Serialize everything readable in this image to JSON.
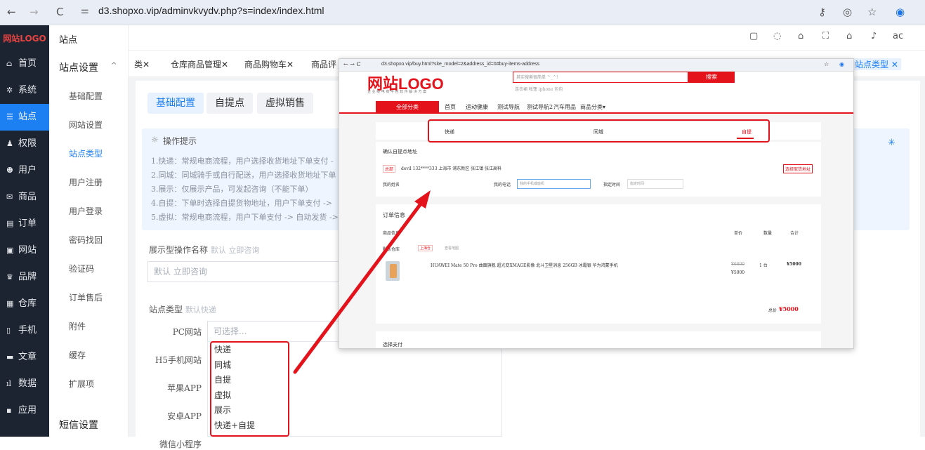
{
  "browser": {
    "back": "←",
    "forward": "→",
    "reload": "C",
    "site_info": "⚌",
    "url": "d3.shopxo.vip/adminvkvydv.php?s=index/index.html"
  },
  "sidebar": {
    "logo": "网站LOGO",
    "items": [
      {
        "icon": "⌂",
        "label": "首页"
      },
      {
        "icon": "✲",
        "label": "系统"
      },
      {
        "icon": "☰",
        "label": "站点"
      },
      {
        "icon": "♟",
        "label": "权限"
      },
      {
        "icon": "☻",
        "label": "用户"
      },
      {
        "icon": "✉",
        "label": "商品"
      },
      {
        "icon": "▤",
        "label": "订单"
      },
      {
        "icon": "▣",
        "label": "网站"
      },
      {
        "icon": "♛",
        "label": "品牌"
      },
      {
        "icon": "▦",
        "label": "仓库"
      },
      {
        "icon": "▯",
        "label": "手机"
      },
      {
        "icon": "▬",
        "label": "文章"
      },
      {
        "icon": "ıl",
        "label": "数据"
      },
      {
        "icon": "▪",
        "label": "应用"
      }
    ]
  },
  "submenu": {
    "title": "站点",
    "group": "站点设置",
    "items": [
      "基础配置",
      "网站设置",
      "站点类型",
      "用户注册",
      "用户登录",
      "密码找回",
      "验证码",
      "订单售后",
      "附件",
      "缓存",
      "扩展项"
    ],
    "group2": "短信设置"
  },
  "topbar": {
    "user": "ac"
  },
  "tabs": [
    "类✕",
    "仓库商品管理✕",
    "商品购物车✕",
    "商品评",
    "站点类型 ✕"
  ],
  "config_tabs": [
    "基础配置",
    "自提点",
    "虚拟销售"
  ],
  "tips": {
    "title": "操作提示",
    "lines": [
      "1.快递：常规电商流程，用户选择收货地址下单支付 -",
      "2.同城：同城骑手或自行配送，用户选择收货地址下单",
      "3.展示：仅展示产品，可发起咨询（不能下单）",
      "4.自提：下单时选择自提货物地址，用户下单支付 ->",
      "5.虚拟：常规电商流程，用户下单支付 -> 自动发货 ->"
    ]
  },
  "form": {
    "display_label": "展示型操作名称",
    "display_hint": "默认 立即咨询",
    "display_placeholder": "默认 立即咨询",
    "site_type_label": "站点类型",
    "site_type_hint": "默认快递",
    "rows": [
      "PC网站",
      "H5手机网站",
      "苹果APP",
      "安卓APP",
      "微信小程序"
    ],
    "pc_placeholder": "可选择...",
    "dropdown_options": [
      "快递",
      "同城",
      "自提",
      "虚拟",
      "展示",
      "快递+自提"
    ]
  },
  "overlay": {
    "url": "d3.shopxo.vip/buy.html?site_model=2&address_id=0#buy-items-address",
    "logo": "网站LOGO",
    "logo_sub": "企 业 级 电 商 平 台 软 件 解 决 方 案",
    "search_placeholder": "其实搜索很简单 ^_^!",
    "search_btn": "搜索",
    "search_tags": "连衣裙  帐篷  iphone  包包",
    "nav": [
      "全部分类",
      "首页",
      "运动健康",
      "测试导航",
      "测试导航2",
      "汽车用品",
      "商品分类▾"
    ],
    "delivery_tabs": [
      "快递",
      "同城",
      "自提"
    ],
    "pickup_title": "确认自提点地址",
    "pickup_tag": "总部",
    "pickup_addr": "devil 132****333 上海市 浦东新区 张江镇 张江高科",
    "pickup_btn": "选择取货地址",
    "name_label": "我的姓名",
    "phone_label": "我的电话",
    "phone_placeholder": "我的手机或座机",
    "time_label": "指定时间",
    "time_placeholder": "指定时间",
    "order_title": "订单信息",
    "goods_header": "商品信息",
    "price_header": "单价",
    "qty_header": "数量",
    "total_header": "合计",
    "warehouse": "默认仓库",
    "warehouse_tag": "上海仓",
    "map_link": "查看地图",
    "product": "HUAWEI Mate 50 Pro 曲面旗舰 超光变XMAGE影像 北斗卫星消息 256GB 冰霜银 华为鸿蒙手机",
    "orig_price": "¥6800",
    "price": "¥5000",
    "qty": "1 台",
    "line_total": "¥5000",
    "total_label": "总价",
    "total": "¥5000",
    "pay_title": "选择支付"
  },
  "colors": {
    "accent": "#1c7ff2",
    "sidebar_bg": "#1c2431",
    "highlight": "#e4121b"
  }
}
